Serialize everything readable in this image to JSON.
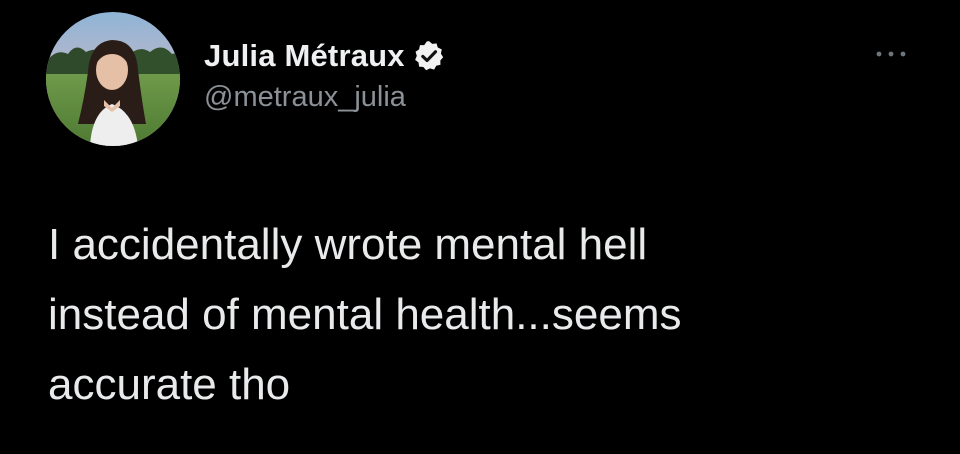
{
  "tweet": {
    "display_name": "Julia Métraux",
    "handle": "@metraux_julia",
    "verified": true,
    "text": "I accidentally wrote mental hell\ninstead of mental health...seems\naccurate tho"
  },
  "icons": {
    "verified": "verified-badge-icon",
    "more": "more-options-icon"
  },
  "colors": {
    "background": "#000000",
    "text_primary": "#e7e9ea",
    "text_secondary": "#8b9197"
  }
}
